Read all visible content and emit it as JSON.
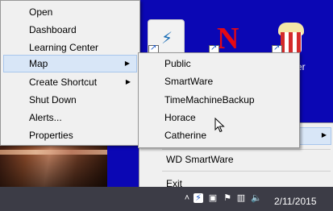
{
  "context_menu": {
    "items": [
      {
        "label": "Open"
      },
      {
        "label": "Dashboard"
      },
      {
        "label": "Learning Center"
      },
      {
        "label": "Map",
        "has_submenu": true
      },
      {
        "label": "Create Shortcut",
        "has_submenu": true
      },
      {
        "label": "Shut Down"
      },
      {
        "label": "Alerts..."
      },
      {
        "label": "Properties"
      }
    ]
  },
  "map_submenu": {
    "items": [
      {
        "label": "Public"
      },
      {
        "label": "SmartWare"
      },
      {
        "label": "TimeMachineBackup"
      },
      {
        "label": "Horace"
      },
      {
        "label": "Catherine"
      }
    ]
  },
  "tray_menu": {
    "items": [
      {
        "label": "WD SmartWare"
      },
      {
        "label": "Exit"
      }
    ]
  },
  "desktop": {
    "netflix_glyph": "N",
    "partial_label": "er"
  },
  "taskbar": {
    "clock": "2/11/2015"
  },
  "colors": {
    "desktop": "#0b07b4",
    "menu_bg": "#f0f0f0",
    "highlight": "#d8e6f7",
    "taskbar": "#3c3c46"
  }
}
